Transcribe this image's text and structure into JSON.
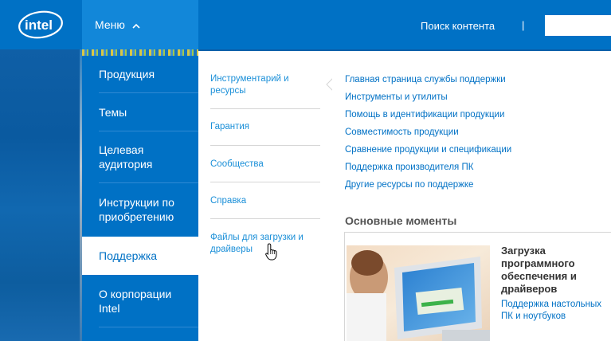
{
  "header": {
    "logo_text": "intel",
    "menu_label": "Меню",
    "search_link": "Поиск контента",
    "separator": "|",
    "search_placeholder": ""
  },
  "nav_level1": [
    {
      "label": "Продукция",
      "active": false
    },
    {
      "label": "Темы",
      "active": false
    },
    {
      "label": "Целевая аудитория",
      "active": false
    },
    {
      "label": "Инструкции по приобретению",
      "active": false
    },
    {
      "label": "Поддержка",
      "active": true
    },
    {
      "label": "О корпорации Intel",
      "active": false
    }
  ],
  "nav_level2": [
    {
      "label": "Инструментарий и ресурсы",
      "expanded": true
    },
    {
      "label": "Гарантия"
    },
    {
      "label": "Сообщества"
    },
    {
      "label": "Справка"
    },
    {
      "label": "Файлы для загрузки и драйверы",
      "hovered": true
    }
  ],
  "nav_level3": {
    "links": [
      "Главная страница службы поддержки",
      "Инструменты и утилиты",
      "Помощь в идентификации продукции",
      "Совместимость продукции",
      "Сравнение продукции и спецификации",
      "Поддержка производителя ПК",
      "Другие ресурсы по поддержке"
    ],
    "highlights_title": "Основные моменты",
    "highlight": {
      "heading": "Загрузка программного обеспечения и драйверов",
      "link": "Поддержка настольных ПК и ноутбуков"
    }
  },
  "colors": {
    "brand_blue": "#0071c5",
    "menu_button": "#1287d9",
    "link_light": "#1a8fd8"
  }
}
